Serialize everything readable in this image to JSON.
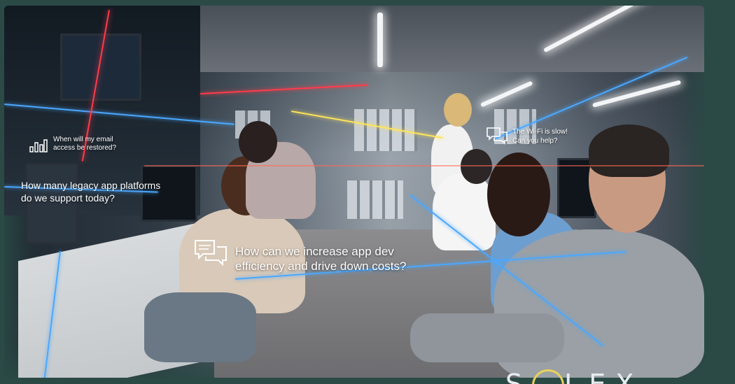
{
  "scene": {
    "description_tags": [
      "office-photo",
      "data-overlay"
    ]
  },
  "overlays": {
    "email_question": "When will my email access be restored?",
    "legacy_question_line1": "How many legacy app platforms",
    "legacy_question_line2": "do we support today?",
    "wifi_question_line1": "The Wi-Fi is slow!",
    "wifi_question_line2": "Can you help?",
    "main_question_line1": "How can we increase app dev",
    "main_question_line2": "efficiency and drive down costs?"
  },
  "icons": {
    "chart": "bar-chart-icon",
    "chat_small": "chat-bubbles-icon",
    "chat_main": "chat-bubbles-icon"
  },
  "logo": {
    "text_left": "S",
    "text_right": "LEX"
  },
  "colors": {
    "background": "#2b4a46",
    "beam_blue": "#4aa8ff",
    "beam_red": "#ff3b4a",
    "beam_yellow": "#ffe45a",
    "logo_ring": "#e6d25a"
  }
}
